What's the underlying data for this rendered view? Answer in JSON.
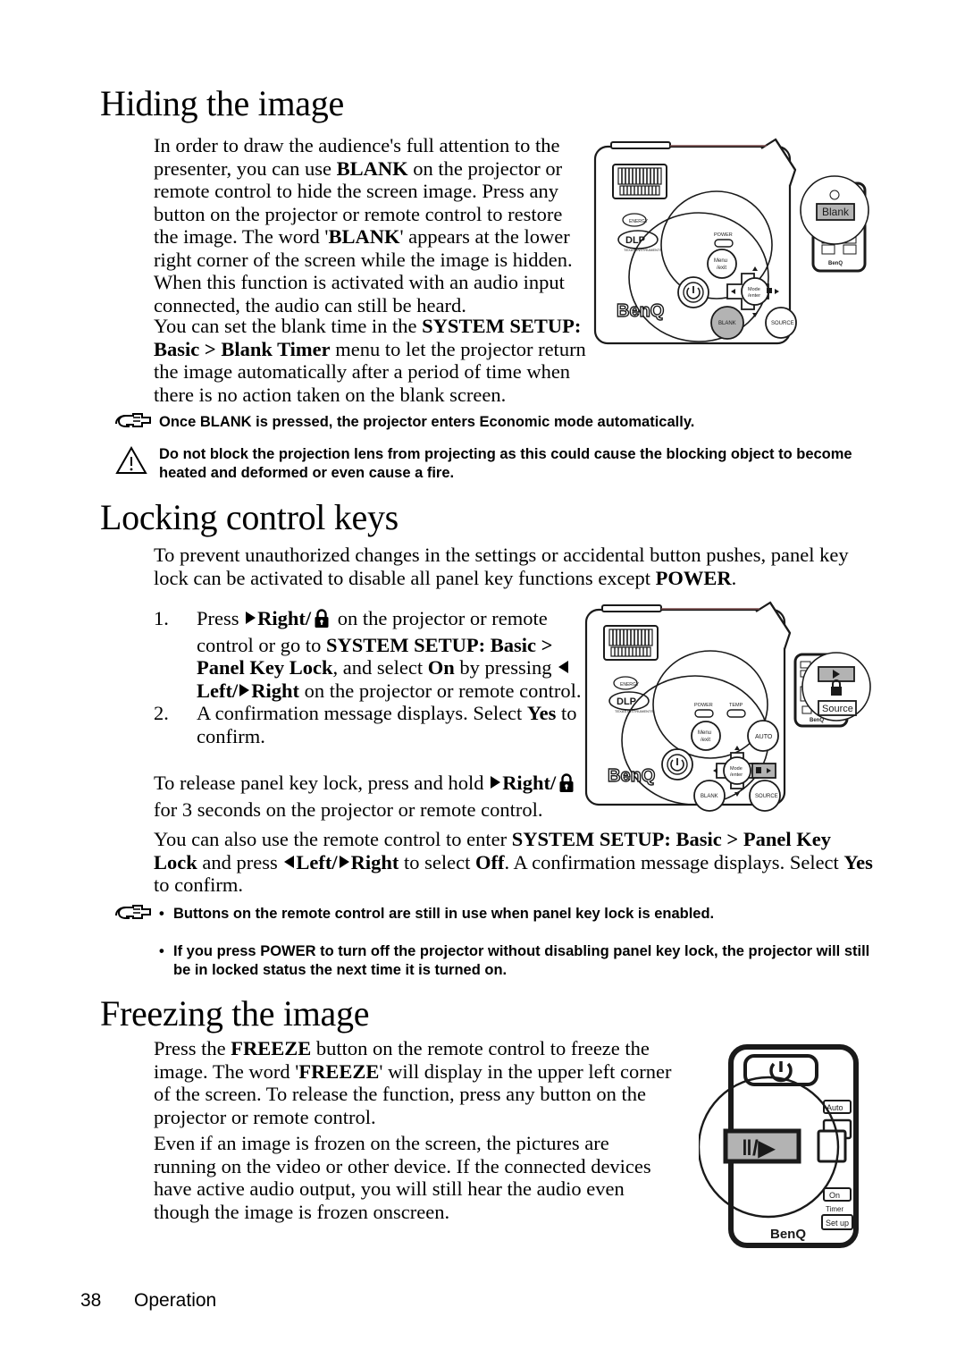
{
  "document": {
    "footer": {
      "page_number": "38",
      "section": "Operation"
    }
  },
  "sections": {
    "hiding": {
      "title": "Hiding the image",
      "paragraph_1_pre": "In order to draw the audience's full attention to the presenter, you can use ",
      "paragraph_1_b1": "BLANK",
      "paragraph_1_mid": " on the projector or remote control to hide the screen image. Press any button on the projector or remote control to restore the image. The word '",
      "paragraph_1_b2": "BLANK",
      "paragraph_1_post": "' appears at the lower right corner of the screen while the image is hidden. When this function is activated with an audio input connected, the audio can still be heard.",
      "paragraph_2_pre": "You can set the blank time in the ",
      "paragraph_2_b1": "SYSTEM SETUP: Basic > Blank Timer",
      "paragraph_2_post": " menu to let the projector return the image automatically after a period of time when there is no action taken on the blank screen.",
      "note": "Once BLANK is pressed, the projector enters Economic mode automatically.",
      "caution": "Do not block the projection lens from projecting as this could cause the blocking object to become heated and deformed or even cause a fire."
    },
    "locking": {
      "title": "Locking control keys",
      "intro_pre": "To prevent unauthorized changes in the settings or accidental button pushes, panel key lock can be activated to disable all panel key functions except ",
      "intro_b1": "POWER",
      "intro_post": ".",
      "steps": [
        {
          "number": "1.",
          "t1": "Press ",
          "b1": "Right/",
          "t2": " on the projector or remote control or go to ",
          "b2": "SYSTEM SETUP: Basic > Panel Key Lock",
          "t3": ", and select ",
          "b3": "On",
          "t4": " by pressing ",
          "b4": "Left/",
          "b5": "Right",
          "t5": " on the projector or remote control."
        },
        {
          "number": "2.",
          "t1": "A confirmation message displays. Select ",
          "b1": "Yes",
          "t2": " to confirm."
        }
      ],
      "release_pre": "To release panel key lock, press and hold ",
      "release_b1": "Right/",
      "release_post": " for 3 seconds on the projector or remote control.",
      "remote_pre": "You can also use the remote control to enter ",
      "remote_b1": "SYSTEM SETUP: Basic > Panel Key Lock",
      "remote_mid": " and press ",
      "remote_b2": "Left/",
      "remote_b3": "Right",
      "remote_mid2": " to select ",
      "remote_b4": "Off",
      "remote_post": ". A confirmation message displays. Select ",
      "remote_b5": "Yes",
      "remote_post2": " to confirm.",
      "notes": [
        "Buttons on the remote control are still in use when panel key lock is enabled.",
        "If you press POWER to turn off the projector without disabling panel key lock, the projector will still be in locked status the next time it is turned on."
      ]
    },
    "freezing": {
      "title": "Freezing the image",
      "paragraph_1_pre": "Press the ",
      "paragraph_1_b1": "FREEZE",
      "paragraph_1_mid": " button on the remote control to freeze the image. The word '",
      "paragraph_1_b2": "FREEZE",
      "paragraph_1_post": "' will display in the upper left corner of the screen. To release the function, press any button on the projector or remote control.",
      "paragraph_2": "Even if an image is frozen on the screen, the pictures are running on the video or other device. If the connected devices have active audio output, you will still hear the audio even though the image is frozen onscreen."
    }
  },
  "illustrations": {
    "projector_blank": {
      "brand": "BenQ",
      "dlp_badge": "DLP",
      "dlp_sub": "TEXAS INSTRUMENTS",
      "led_power": "POWER",
      "buttons": {
        "menu": "Menu",
        "exit": "Exit",
        "mode": "Mode",
        "enter": "Enter",
        "blank": "BLANK",
        "source": "SOURCE"
      },
      "remote": {
        "brand": "BenQ",
        "highlight_button": "Blank"
      }
    },
    "projector_lock": {
      "brand": "BenQ",
      "dlp_badge": "DLP",
      "dlp_sub": "TEXAS INSTRUMENTS",
      "led_power": "POWER",
      "led_temp": "TEMP",
      "buttons": {
        "menu": "Menu",
        "exit": "Exit",
        "mode": "Mode",
        "enter": "Enter",
        "auto": "AUTO",
        "blank": "BLANK",
        "source": "SOURCE"
      },
      "remote": {
        "brand": "BenQ",
        "highlight_source": "Source"
      }
    },
    "remote_freeze": {
      "brand": "BenQ",
      "highlight_button": "‖/▶",
      "labels": {
        "auto": "Auto",
        "on": "On",
        "timer": "Timer",
        "setup": "Set up"
      }
    }
  },
  "colors": {
    "ink": "#000000",
    "page": "#ffffff",
    "button_shade": "#b3b3b3",
    "line": "#1a1a1a"
  }
}
